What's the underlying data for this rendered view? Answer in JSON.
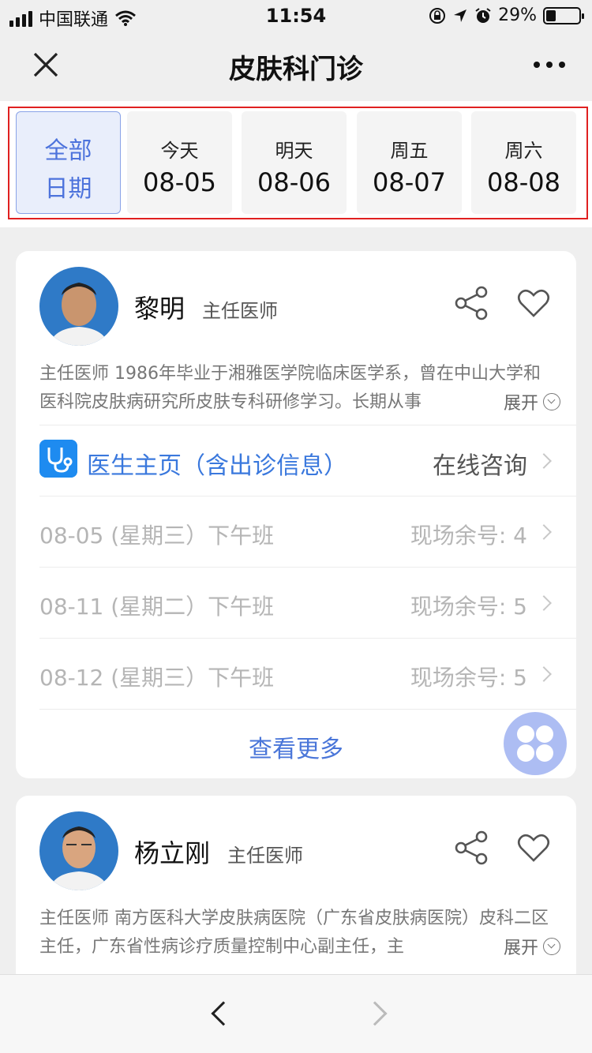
{
  "status_bar": {
    "carrier": "中国联通",
    "time": "11:54",
    "battery": "29%",
    "battery_level": 0.29
  },
  "nav": {
    "title": "皮肤科门诊",
    "close_icon": "close-icon",
    "more_icon": "more-icon"
  },
  "dates": [
    {
      "week": "全部",
      "date": "日期",
      "active": true
    },
    {
      "week": "今天",
      "date": "08-05"
    },
    {
      "week": "明天",
      "date": "08-06"
    },
    {
      "week": "周五",
      "date": "08-07"
    },
    {
      "week": "周六",
      "date": "08-08"
    }
  ],
  "doctors": [
    {
      "name": "黎明",
      "title": "主任医师",
      "intro": "主任医师 1986年毕业于湘雅医学院临床医学系，曾在中山大学和医科院皮肤病研究所皮肤专科研修学习。长期从事",
      "expand": "展开",
      "home_link": "医生主页（含出诊信息）",
      "consult": "在线咨询",
      "schedules": [
        {
          "left": "08-05 (星期三）下午班",
          "right": "现场余号: 4"
        },
        {
          "left": "08-11 (星期二）下午班",
          "right": "现场余号: 5"
        },
        {
          "left": "08-12 (星期三）下午班",
          "right": "现场余号: 5"
        }
      ],
      "more": "查看更多"
    },
    {
      "name": "杨立刚",
      "title": "主任医师",
      "intro": "主任医师 南方医科大学皮肤病医院（广东省皮肤病医院）皮科二区主任，广东省性病诊疗质量控制中心副主任，主",
      "expand": "展开"
    }
  ],
  "colors": {
    "accent": "#4d73dc",
    "highlight_frame": "#e02020",
    "home_icon": "#1e8bf0",
    "float_button": "#a9baf3"
  }
}
